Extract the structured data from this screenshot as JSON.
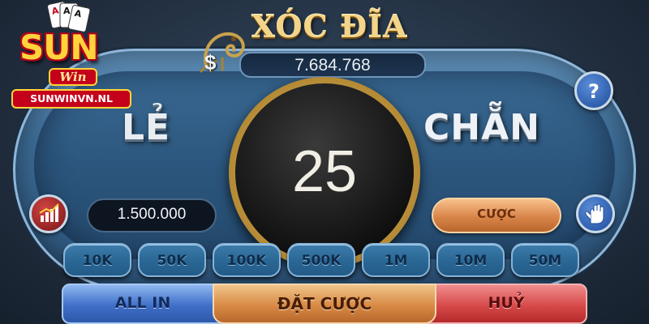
{
  "game": {
    "title": "XÓC ĐĨA"
  },
  "logo": {
    "brand": "SUN",
    "sub": "Win",
    "url": "SUNWINVN.NL"
  },
  "balance": {
    "currency_symbol": "$",
    "value": "7.684.768"
  },
  "sides": {
    "odd": "LẺ",
    "even": "CHẴN"
  },
  "timer": {
    "countdown": "25"
  },
  "bet": {
    "amount": "1.500.000",
    "bet_label": "CƯỢC"
  },
  "chips": [
    "10K",
    "50K",
    "100K",
    "500K",
    "1M",
    "10M",
    "50M"
  ],
  "actions": {
    "all_in": "ALL IN",
    "place_bet": "ĐẶT CƯỢC",
    "cancel": "HUỶ"
  },
  "icons": {
    "help": "question-icon",
    "stats": "bar-chart-icon",
    "stop": "hand-icon",
    "currency": "dollar-icon",
    "decoration": "dragon-icon"
  },
  "colors": {
    "gold": "#f3d58a",
    "table_blue": "#3b6a94",
    "all_in_blue": "#3f6fc8",
    "place_orange": "#d88a45",
    "cancel_red": "#d84a4a"
  }
}
